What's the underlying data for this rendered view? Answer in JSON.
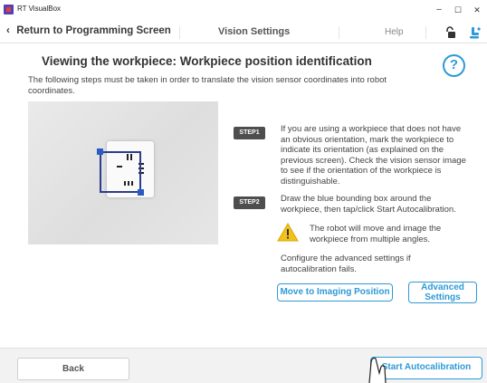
{
  "window": {
    "title": "RT VisualBox",
    "controls": {
      "minimize": "–",
      "maximize": "☐",
      "close": "✕"
    }
  },
  "nav": {
    "back_label": "Return to Programming Screen",
    "title": "Vision Settings",
    "help_label": "Help",
    "icons": [
      "chevron-left-icon",
      "unlock-icon",
      "robot-icon"
    ]
  },
  "page": {
    "heading": "Viewing the workpiece: Workpiece position identification",
    "intro": "The following steps must be taken in order to translate the vision sensor coordinates into robot coordinates.",
    "help_symbol": "?"
  },
  "steps": [
    {
      "badge": "STEP1",
      "text": "If you are using a workpiece that does not have an obvious orientation, mark the workpiece to indicate its orientation (as explained on the previous screen). Check the vision sensor image to see if the orientation of the workpiece is distinguishable."
    },
    {
      "badge": "STEP2",
      "text": "Draw the blue bounding box around the workpiece, then tap/click Start Autocalibration."
    }
  ],
  "warning": {
    "text": "The robot will move and image the workpiece from multiple angles.",
    "icon": "warning-icon",
    "color": "#f2c21b"
  },
  "advanced_note": "Configure the advanced settings if autocalibration fails.",
  "buttons": {
    "move_to_imaging": "Move to Imaging Position",
    "advanced_settings": "Advanced Settings",
    "back": "Back",
    "start_autocalibration": "Start Autocalibration"
  },
  "colors": {
    "accent": "#2e9ad6",
    "bounding_box": "#2a3d8f",
    "step_badge": "#4e4e4e"
  }
}
